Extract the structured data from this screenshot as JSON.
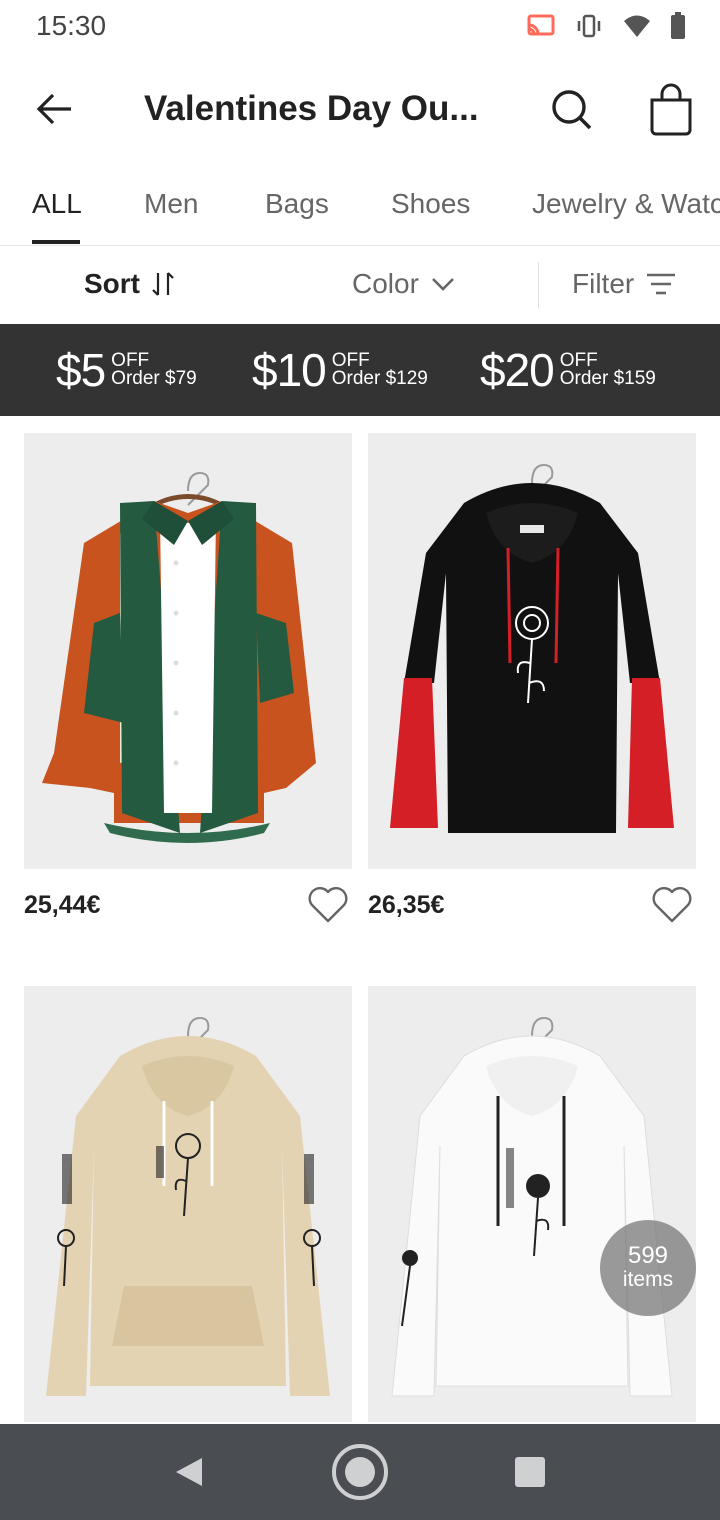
{
  "status_bar": {
    "time": "15:30",
    "icons": [
      "cast-icon",
      "vibrate-icon",
      "wifi-icon",
      "battery-icon"
    ]
  },
  "header": {
    "title": "Valentines Day Ou...",
    "back_icon": "arrow-left-icon",
    "search_icon": "search-icon",
    "bag_icon": "shopping-bag-icon"
  },
  "tabs": [
    {
      "label": "ALL",
      "active": true
    },
    {
      "label": "Men",
      "active": false
    },
    {
      "label": "Bags",
      "active": false
    },
    {
      "label": "Shoes",
      "active": false
    },
    {
      "label": "Jewelry & Watc",
      "active": false
    }
  ],
  "filter_bar": {
    "sort_label": "Sort",
    "color_label": "Color",
    "filter_label": "Filter"
  },
  "promo": [
    {
      "amount": "$5",
      "off": "OFF",
      "min": "Order $79"
    },
    {
      "amount": "$10",
      "off": "OFF",
      "min": "Order $129"
    },
    {
      "amount": "$20",
      "off": "OFF",
      "min": "Order $159"
    }
  ],
  "products": [
    {
      "price": "25,44€",
      "image": "corduroy-colorblock-shirt"
    },
    {
      "price": "26,35€",
      "image": "black-rose-hoodie-red-sleeves"
    },
    {
      "price": "",
      "image": "beige-rose-hoodie"
    },
    {
      "price": "",
      "image": "white-rose-hoodie"
    }
  ],
  "items_badge": {
    "count": "599",
    "label": "items"
  },
  "colors": {
    "promo_bg": "#333333",
    "nav_bg": "#4a4d52",
    "text": "#222222",
    "muted": "#666666"
  }
}
